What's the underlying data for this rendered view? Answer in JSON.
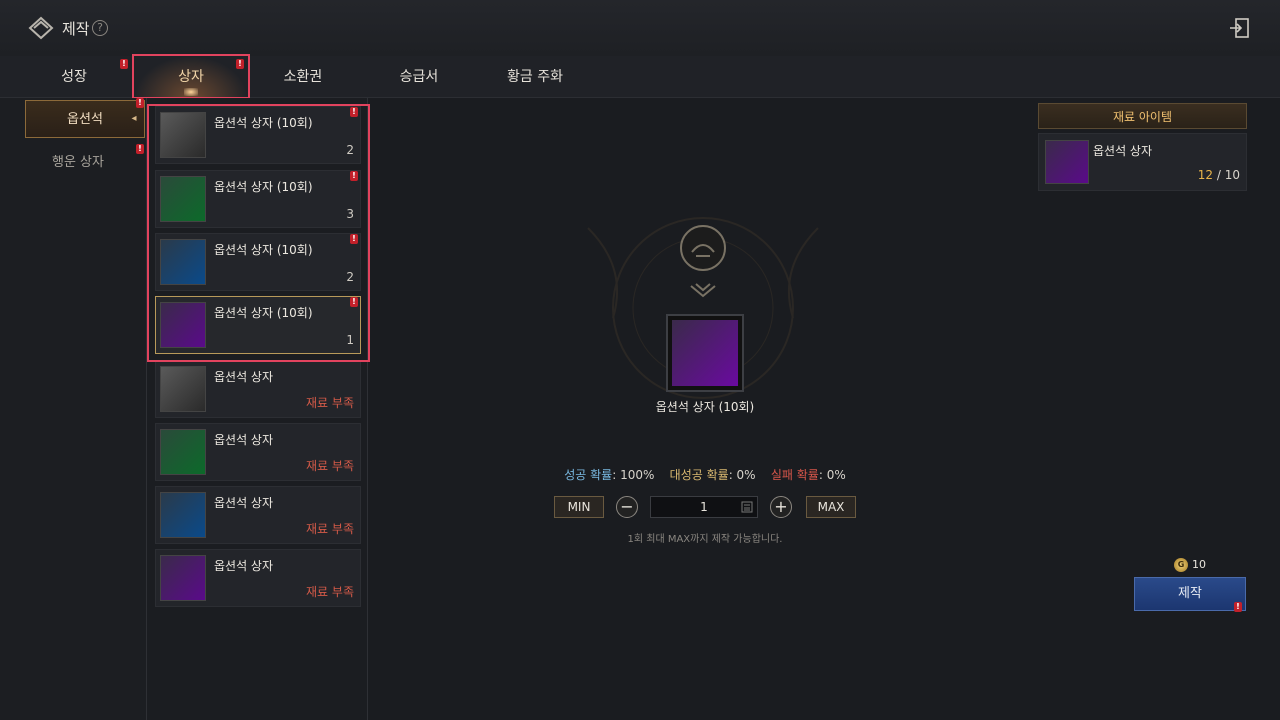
{
  "header": {
    "title": "제작",
    "help_label": "?"
  },
  "tabs": [
    {
      "label": "성장"
    },
    {
      "label": "상자"
    },
    {
      "label": "소환권"
    },
    {
      "label": "승급서"
    },
    {
      "label": "황금 주화"
    }
  ],
  "badge_text": "!",
  "sidebar": {
    "items": [
      {
        "label": "옵션석"
      },
      {
        "label": "행운 상자"
      }
    ]
  },
  "recipes": [
    {
      "name": "옵션석 상자 (10회)",
      "value": "2",
      "color": "gray"
    },
    {
      "name": "옵션석 상자 (10회)",
      "value": "3",
      "color": "green"
    },
    {
      "name": "옵션석 상자 (10회)",
      "value": "2",
      "color": "blue"
    },
    {
      "name": "옵션석 상자 (10회)",
      "value": "1",
      "color": "purple"
    },
    {
      "name": "옵션석 상자",
      "value": "재료 부족",
      "color": "gray"
    },
    {
      "name": "옵션석 상자",
      "value": "재료 부족",
      "color": "green"
    },
    {
      "name": "옵션석 상자",
      "value": "재료 부족",
      "color": "blue"
    },
    {
      "name": "옵션석 상자",
      "value": "재료 부족",
      "color": "purple"
    }
  ],
  "result": {
    "name": "옵션석 상자 (10회)",
    "success_label": "성공 확률",
    "success_value": ": 100%",
    "great_label": "대성공 확률",
    "great_value": ": 0%",
    "fail_label": "실패 확률",
    "fail_value": ": 0%"
  },
  "quantity": {
    "min_label": "MIN",
    "max_label": "MAX",
    "minus": "−",
    "plus": "+",
    "value": "1",
    "hint": "1회 최대 MAX까지 제작 가능합니다."
  },
  "materials": {
    "header": "재료 아이템",
    "item_name": "옵션석 상자",
    "have": "12",
    "need": " / 10"
  },
  "cost": {
    "coin_label": "G",
    "amount": "10"
  },
  "craft_button": {
    "label": "제작"
  },
  "colors": {
    "success": "#79b8e0",
    "great_success": "#d9b870",
    "fail": "#d8564a",
    "highlight": "#e2435e",
    "accent": "#e8b44a"
  }
}
